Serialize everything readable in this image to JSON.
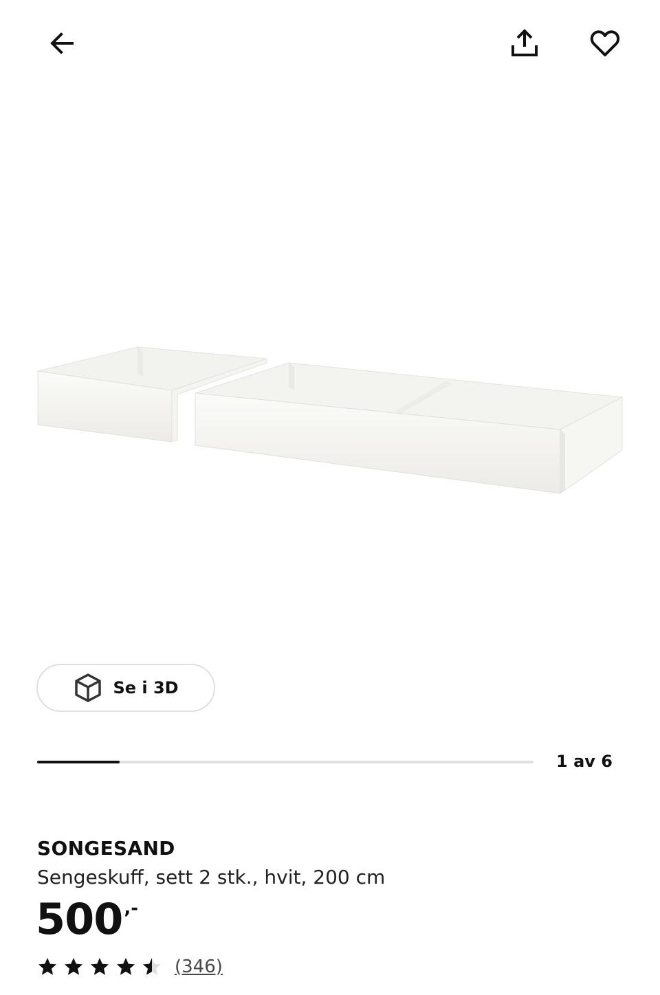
{
  "header": {
    "back_icon": "arrow-left-icon",
    "share_icon": "share-upload-icon",
    "favorite_icon": "heart-outline-icon"
  },
  "product_image": {
    "alt": "Hvite sengeskuffer",
    "icon": "bed-drawer-image"
  },
  "view3d": {
    "label": "Se i 3D",
    "icon": "cube-3d-icon"
  },
  "carousel": {
    "current": 1,
    "total": 6,
    "counter_text": "1 av 6",
    "progress_fraction": 0.1667,
    "progress_color": "#111111",
    "track_color": "#dfdfdf"
  },
  "product": {
    "name": "SONGESAND",
    "description": "Sengeskuff, sett 2 stk., hvit, 200 cm",
    "price_integer": "500",
    "price_decimal": ",-"
  },
  "rating": {
    "value": 4.5,
    "max": 5,
    "review_count_text": "(346)",
    "star_color": "#111111",
    "empty_star_color": "#dfdfdf"
  }
}
